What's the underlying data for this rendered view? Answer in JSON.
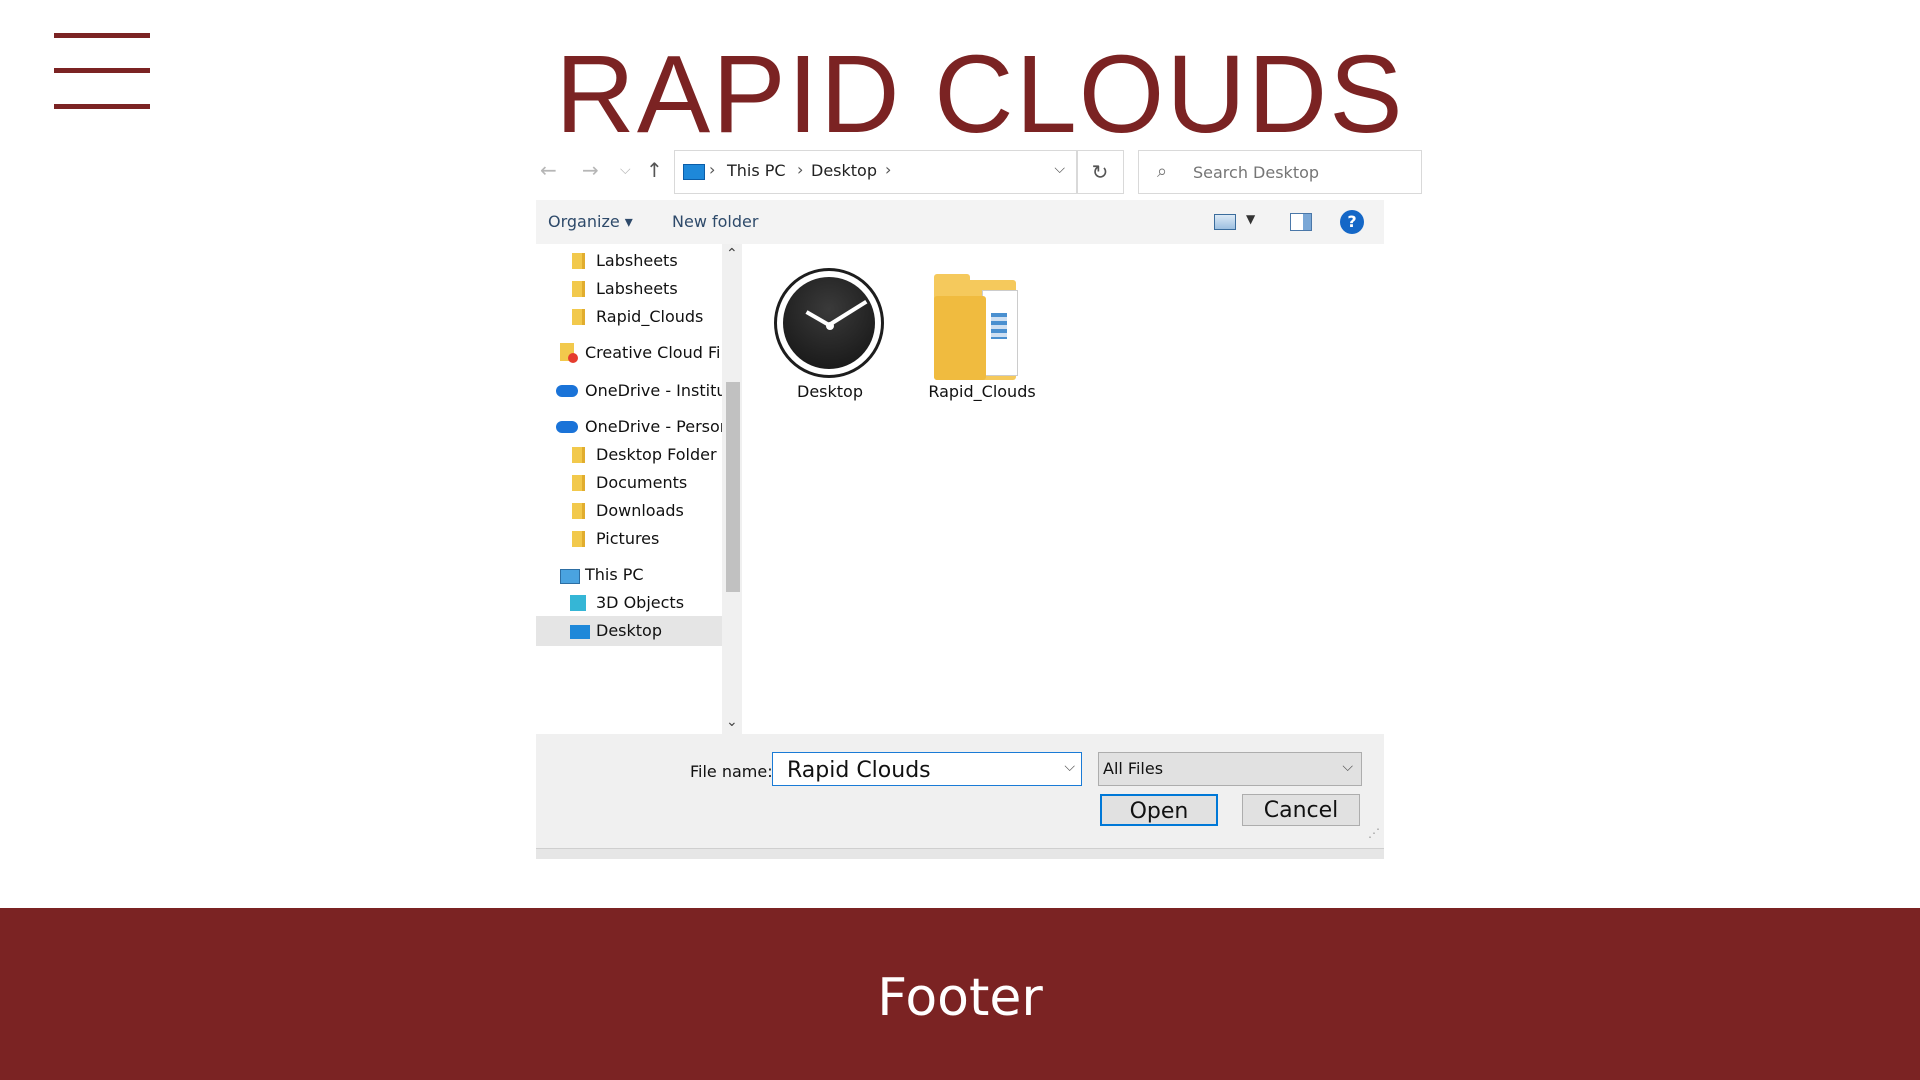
{
  "app": {
    "title": "RAPID CLOUDS",
    "menu_icon": "hamburger-menu-icon"
  },
  "dialog": {
    "address": {
      "crumbs": [
        "This PC",
        "Desktop"
      ]
    },
    "search": {
      "placeholder": "Search Desktop"
    },
    "toolbar": {
      "organize_label": "Organize ▾",
      "new_folder_label": "New folder",
      "help_label": "?"
    },
    "nav_tree": [
      {
        "label": "Labsheets",
        "icon": "folder-icon"
      },
      {
        "label": "Labsheets",
        "icon": "folder-icon"
      },
      {
        "label": "Rapid_Clouds",
        "icon": "folder-icon"
      },
      {
        "label": "Creative Cloud Files",
        "icon": "creative-cloud-icon"
      },
      {
        "label": "OneDrive - Institute",
        "icon": "onedrive-icon"
      },
      {
        "label": "OneDrive - Personal",
        "icon": "onedrive-icon"
      },
      {
        "label": "Desktop Folder",
        "icon": "folder-icon"
      },
      {
        "label": "Documents",
        "icon": "folder-icon"
      },
      {
        "label": "Downloads",
        "icon": "folder-icon"
      },
      {
        "label": "Pictures",
        "icon": "folder-icon"
      },
      {
        "label": "This PC",
        "icon": "computer-icon"
      },
      {
        "label": "3D Objects",
        "icon": "3d-objects-icon"
      },
      {
        "label": "Desktop",
        "icon": "desktop-icon",
        "selected": true
      }
    ],
    "files": [
      {
        "label": "Desktop",
        "icon": "clock-icon"
      },
      {
        "label": "Rapid_Clouds",
        "icon": "folder-icon"
      }
    ],
    "file_name_label": "File name:",
    "file_name_value": "Rapid Clouds",
    "file_type_value": "All Files",
    "open_label": "Open",
    "cancel_label": "Cancel"
  },
  "footer": {
    "text": "Footer"
  },
  "colors": {
    "brand": "#7b2323",
    "accent": "#0078d7"
  }
}
